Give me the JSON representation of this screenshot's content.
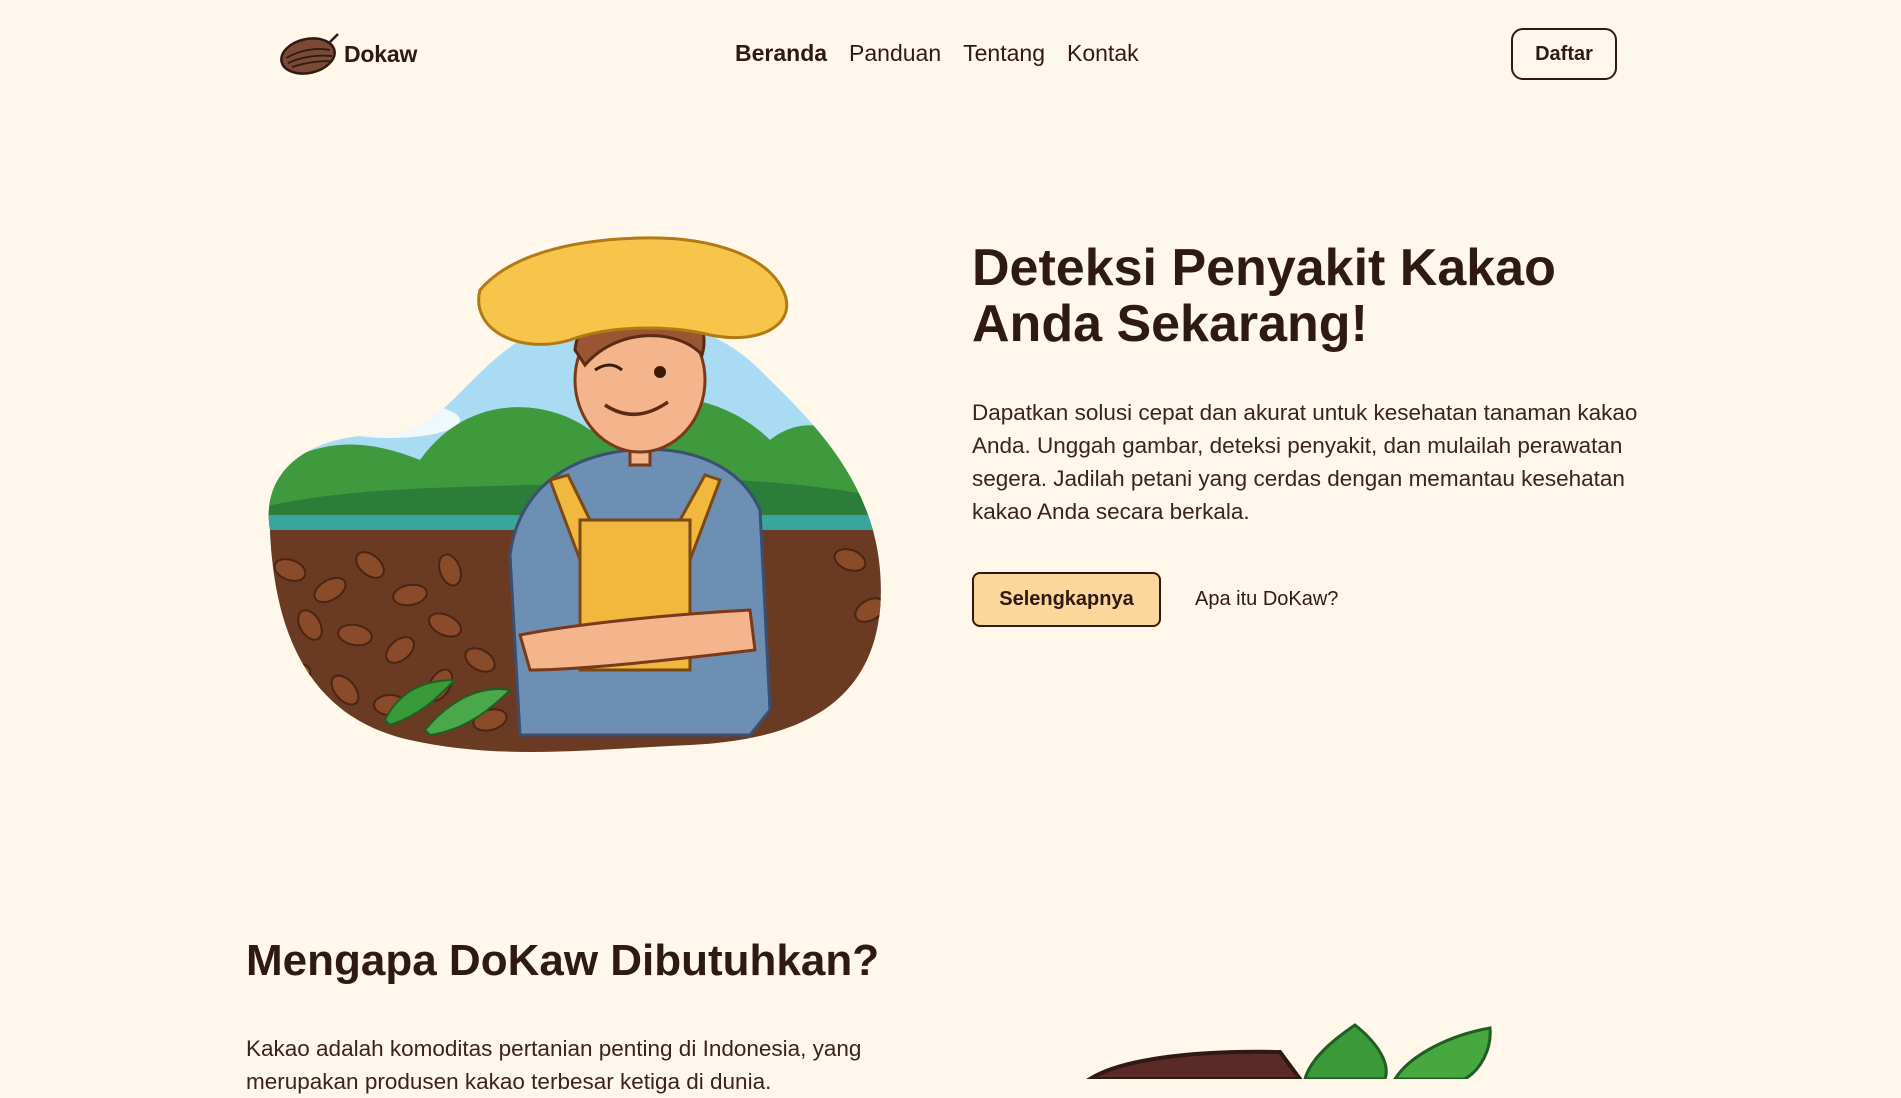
{
  "brand": {
    "name": "Dokaw",
    "logo_icon": "cocoa-pod-icon"
  },
  "nav": {
    "items": [
      {
        "label": "Beranda",
        "active": true
      },
      {
        "label": "Panduan",
        "active": false
      },
      {
        "label": "Tentang",
        "active": false
      },
      {
        "label": "Kontak",
        "active": false
      }
    ],
    "register_label": "Daftar"
  },
  "hero": {
    "title": "Deteksi Penyakit Kakao Anda Sekarang!",
    "description": "Dapatkan solusi cepat dan akurat untuk kesehatan tanaman kakao Anda. Unggah gambar, deteksi penyakit, dan mulailah perawatan segera. Jadilah petani yang cerdas dengan memantau kesehatan kakao Anda secara berkala.",
    "primary_button": "Selengkapnya",
    "secondary_link": "Apa itu DoKaw?"
  },
  "why": {
    "title": "Mengapa DoKaw Dibutuhkan?",
    "description": "Kakao adalah komoditas pertanian penting di Indonesia, yang merupakan produsen kakao terbesar ketiga di dunia."
  },
  "colors": {
    "background": "#fff7ea",
    "text": "#2e1a12",
    "primary_button": "#fcd79b"
  }
}
